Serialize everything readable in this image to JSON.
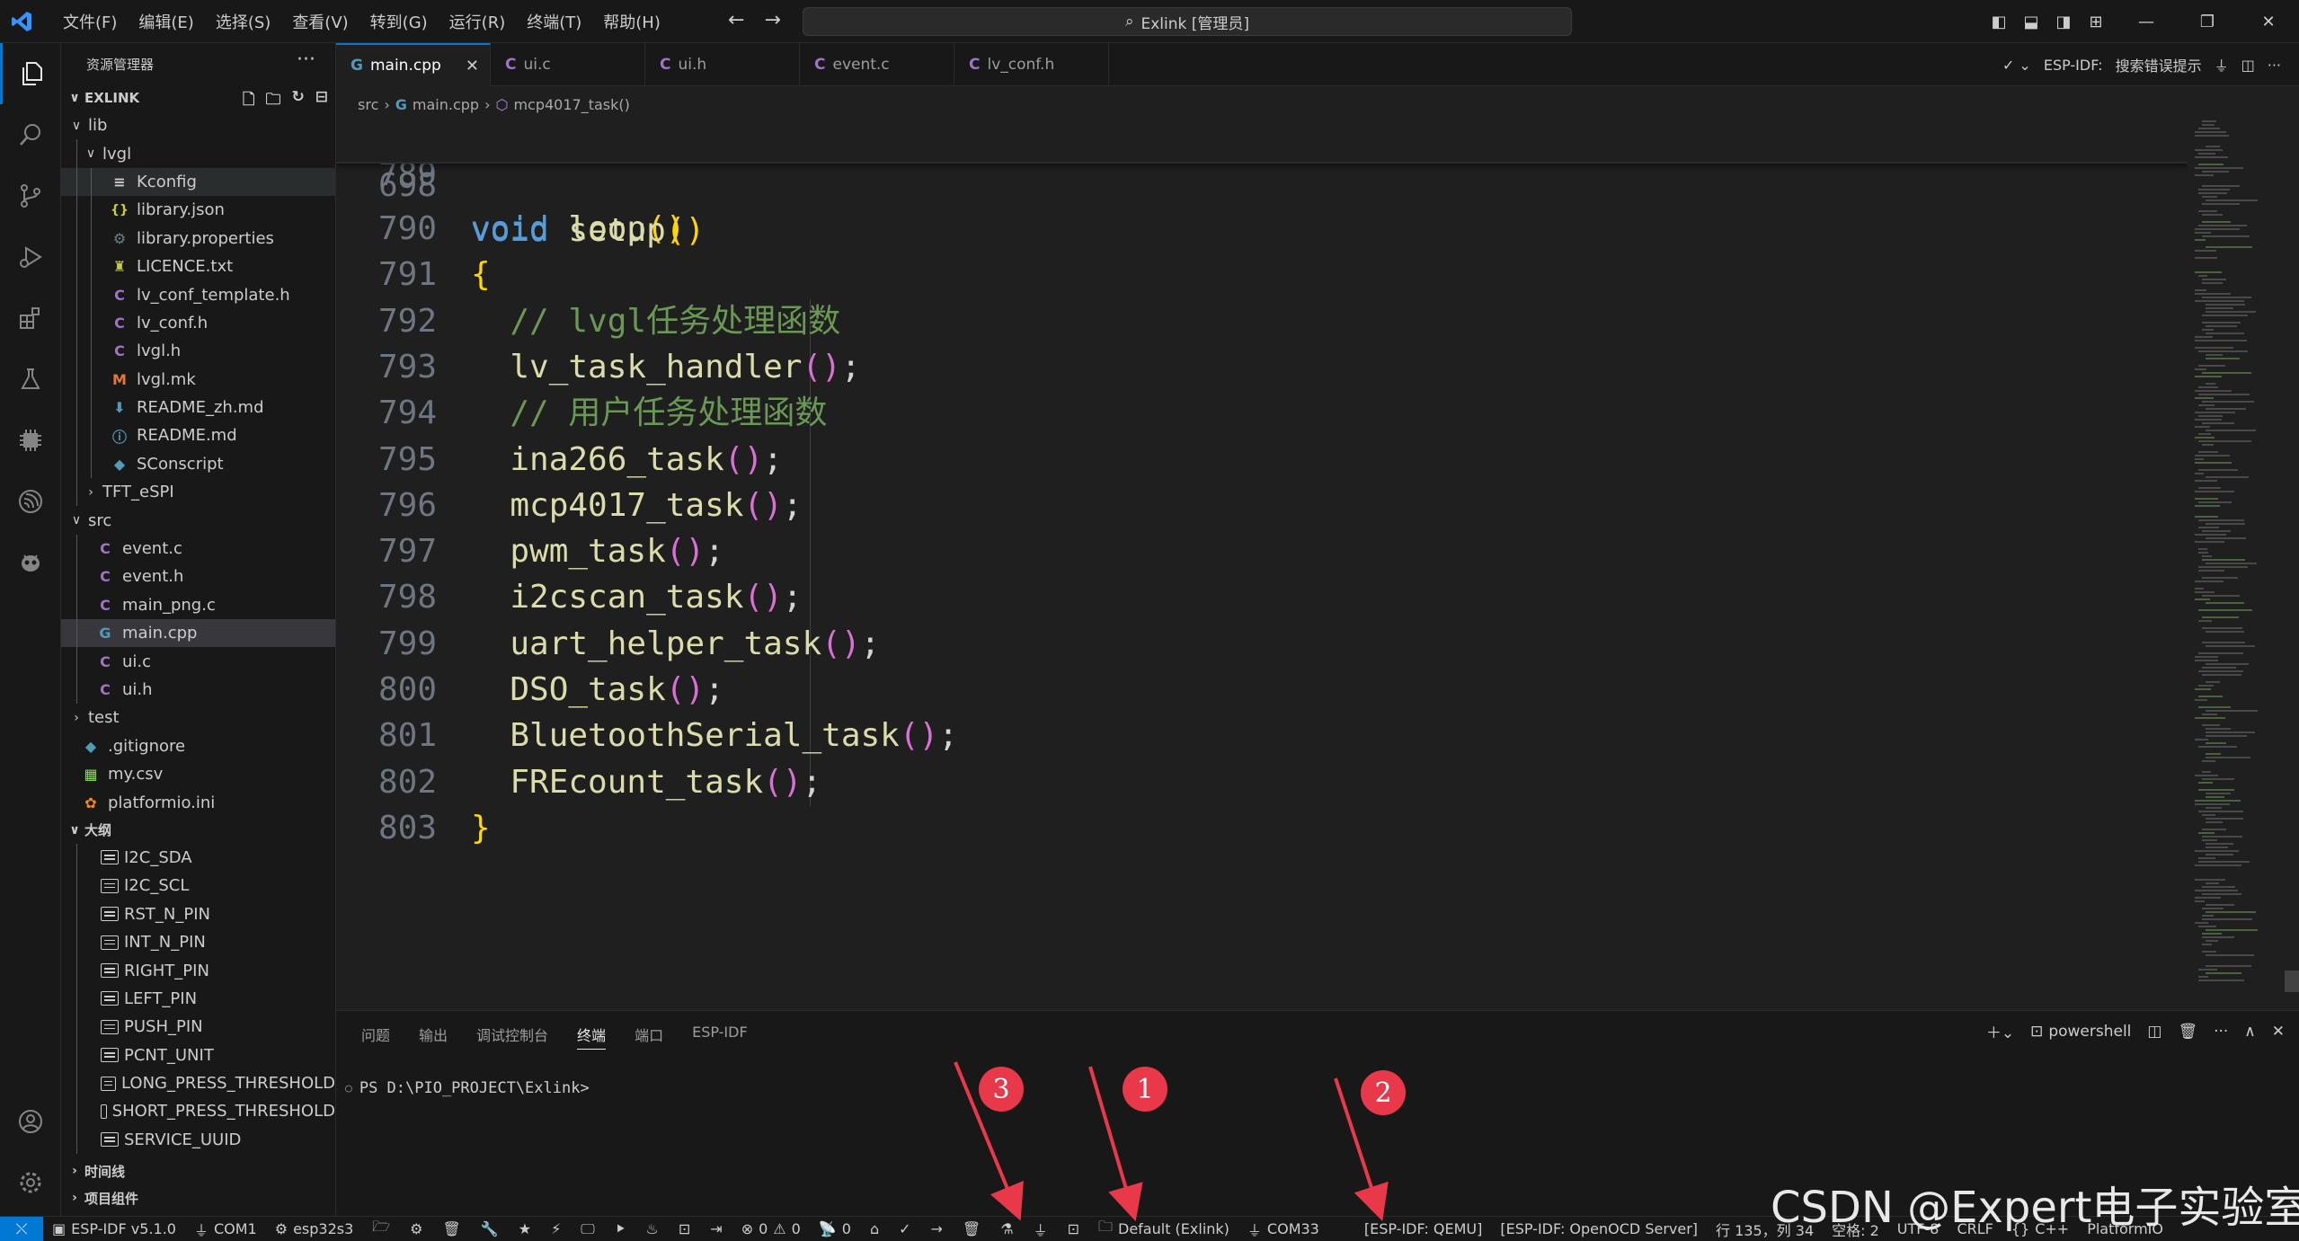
{
  "menu": [
    "文件(F)",
    "编辑(E)",
    "选择(S)",
    "查看(V)",
    "转到(G)",
    "运行(R)",
    "终端(T)",
    "帮助(H)"
  ],
  "search": {
    "text": "Exlink [管理员]"
  },
  "sidebar": {
    "title": "资源管理器",
    "project": "EXLINK",
    "tree": [
      {
        "label": "lib",
        "kind": "folder-open"
      },
      {
        "label": "lvgl",
        "kind": "folder-open"
      },
      {
        "label": "Kconfig",
        "kind": "file",
        "icon": "≡"
      },
      {
        "label": "library.json",
        "kind": "file",
        "icon": "{}"
      },
      {
        "label": "library.properties",
        "kind": "file",
        "icon": "⚙"
      },
      {
        "label": "LICENCE.txt",
        "kind": "file",
        "icon": "♜"
      },
      {
        "label": "lv_conf_template.h",
        "kind": "file",
        "icon": "C"
      },
      {
        "label": "lv_conf.h",
        "kind": "file",
        "icon": "C"
      },
      {
        "label": "lvgl.h",
        "kind": "file",
        "icon": "C"
      },
      {
        "label": "lvgl.mk",
        "kind": "file",
        "icon": "M"
      },
      {
        "label": "README_zh.md",
        "kind": "file",
        "icon": "⬇"
      },
      {
        "label": "README.md",
        "kind": "file",
        "icon": "ⓘ"
      },
      {
        "label": "SConscript",
        "kind": "file",
        "icon": "◆"
      },
      {
        "label": "TFT_eSPI",
        "kind": "folder-closed"
      },
      {
        "label": "src",
        "kind": "folder-open"
      },
      {
        "label": "event.c",
        "kind": "file",
        "icon": "C"
      },
      {
        "label": "event.h",
        "kind": "file",
        "icon": "C"
      },
      {
        "label": "main_png.c",
        "kind": "file",
        "icon": "C"
      },
      {
        "label": "main.cpp",
        "kind": "file",
        "icon": "G"
      },
      {
        "label": "ui.c",
        "kind": "file",
        "icon": "C"
      },
      {
        "label": "ui.h",
        "kind": "file",
        "icon": "C"
      },
      {
        "label": "test",
        "kind": "folder-closed"
      },
      {
        "label": ".gitignore",
        "kind": "file",
        "icon": "◆"
      },
      {
        "label": "my.csv",
        "kind": "file",
        "icon": "▦"
      },
      {
        "label": "platformio.ini",
        "kind": "file",
        "icon": "✿"
      }
    ],
    "outline_title": "大纲",
    "outline": [
      "I2C_SDA",
      "I2C_SCL",
      "RST_N_PIN",
      "INT_N_PIN",
      "RIGHT_PIN",
      "LEFT_PIN",
      "PUSH_PIN",
      "PCNT_UNIT",
      "LONG_PRESS_THRESHOLD",
      "SHORT_PRESS_THRESHOLD",
      "SERVICE_UUID"
    ],
    "timeline_title": "时间线",
    "components_title": "项目组件"
  },
  "tabs": [
    {
      "label": "main.cpp",
      "icon": "G",
      "active": true
    },
    {
      "label": "ui.c",
      "icon": "C"
    },
    {
      "label": "ui.h",
      "icon": "C"
    },
    {
      "label": "event.c",
      "icon": "C"
    },
    {
      "label": "lv_conf.h",
      "icon": "C"
    }
  ],
  "tabs_right": {
    "label1": "ESP-IDF:",
    "label2": "搜索错误提示"
  },
  "breadcrumb": {
    "folder": "src",
    "file": "main.cpp",
    "symbol": "mcp4017_task()"
  },
  "code": {
    "sticky": {
      "num": "698",
      "text": "void setup()"
    },
    "lines": [
      {
        "num": "789",
        "text": ""
      },
      {
        "num": "790",
        "text": "void loop()"
      },
      {
        "num": "791",
        "text": "{"
      },
      {
        "num": "792",
        "text": "  // lvgl任务处理函数"
      },
      {
        "num": "793",
        "text": "  lv_task_handler();"
      },
      {
        "num": "794",
        "text": "  // 用户任务处理函数"
      },
      {
        "num": "795",
        "text": "  ina266_task();"
      },
      {
        "num": "796",
        "text": "  mcp4017_task();"
      },
      {
        "num": "797",
        "text": "  pwm_task();"
      },
      {
        "num": "798",
        "text": "  i2cscan_task();"
      },
      {
        "num": "799",
        "text": "  uart_helper_task();"
      },
      {
        "num": "800",
        "text": "  DSO_task();"
      },
      {
        "num": "801",
        "text": "  BluetoothSerial_task();"
      },
      {
        "num": "802",
        "text": "  FREcount_task();"
      },
      {
        "num": "803",
        "text": "}"
      }
    ]
  },
  "panel": {
    "tabs": [
      "问题",
      "输出",
      "调试控制台",
      "终端",
      "端口",
      "ESP-IDF"
    ],
    "active_tab": "终端",
    "shell": "powershell",
    "prompt": "PS D:\\PIO_PROJECT\\Exlink>"
  },
  "annotations": [
    "3",
    "1",
    "2"
  ],
  "statusbar": {
    "idf_version": "ESP-IDF v5.1.0",
    "port": "COM1",
    "target": "esp32s3",
    "errors": "0",
    "warnings": "0",
    "ports_count": "0",
    "env": "Default (Exlink)",
    "com": "COM33",
    "qemu": "[ESP-IDF: QEMU]",
    "openocd": "[ESP-IDF: OpenOCD Server]",
    "cursor": "行 135，列 34",
    "spaces": "空格: 2",
    "encoding": "UTF-8",
    "eol": "CRLF",
    "language": "C++",
    "platform": "PlatformIO"
  },
  "watermark": "CSDN @Expert电子实验室"
}
